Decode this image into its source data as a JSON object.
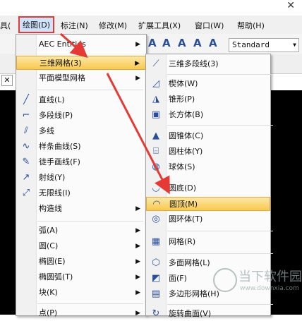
{
  "menubar": {
    "items": [
      {
        "label": "具("
      },
      {
        "label": "绘图(D)"
      },
      {
        "label": "标注(N)"
      },
      {
        "label": "修改(M)"
      },
      {
        "label": "扩展工具(X)"
      },
      {
        "label": "窗口(W)"
      },
      {
        "label": "帮助(H)"
      }
    ]
  },
  "toolbar": {
    "style_value": "Standard"
  },
  "menu1": {
    "items": [
      {
        "label": "AEC Entities",
        "arrow": "▶"
      },
      {
        "label": "三维网格(3)",
        "arrow": "▶"
      },
      {
        "label": "平面模型网格",
        "arrow": "▶"
      },
      {
        "label": "直线(L)"
      },
      {
        "label": "多段线(P)"
      },
      {
        "label": "多线"
      },
      {
        "label": "样条曲线(S)"
      },
      {
        "label": "徒手画线(F)"
      },
      {
        "label": "射线(Y)"
      },
      {
        "label": "无限线(I)"
      },
      {
        "label": "构造线",
        "arrow": "▶"
      },
      {
        "label": "弧(A)",
        "arrow": "▶"
      },
      {
        "label": "圆(C)",
        "arrow": "▶"
      },
      {
        "label": "椭圆(E)",
        "arrow": "▶"
      },
      {
        "label": "椭圆弧(T)",
        "arrow": "▶"
      },
      {
        "label": "块(K)",
        "arrow": "▶"
      },
      {
        "label": "点(P)",
        "arrow": "▶"
      }
    ]
  },
  "menu2": {
    "items": [
      {
        "label": "三维多段线(3)"
      },
      {
        "label": "楔体(W)"
      },
      {
        "label": "锥形(P)"
      },
      {
        "label": "长方体(B)"
      },
      {
        "label": "圆锥体(C)"
      },
      {
        "label": "圆柱体(Y)"
      },
      {
        "label": "球体(S)"
      },
      {
        "label": "圆底(D)"
      },
      {
        "label": "圆顶(M)"
      },
      {
        "label": "圆环体(T)"
      },
      {
        "label": "网格(R)"
      },
      {
        "label": "多面网格(L)"
      },
      {
        "label": "面(F)"
      },
      {
        "label": "多边形网格(H)"
      },
      {
        "label": "旋转曲面(V)"
      }
    ]
  },
  "tab": {
    "close": "✕"
  },
  "window": {
    "close": "✕"
  },
  "watermark": {
    "big": "当下软件园",
    "small": "www.downxia.com"
  }
}
